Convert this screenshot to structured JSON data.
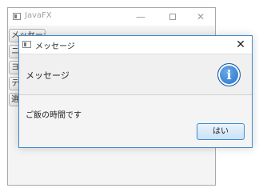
{
  "main_window": {
    "title": "JavaFX",
    "controls": {
      "minimize_icon": "minimize-icon",
      "maximize_icon": "maximize-icon",
      "close_icon": "close-icon",
      "minimize_glyph": "—",
      "close_glyph": "✕"
    },
    "side_buttons": [
      {
        "label": "メッセージ"
      },
      {
        "label": "ニ"
      },
      {
        "label": "ヨ"
      },
      {
        "label": "テ"
      },
      {
        "label": "選"
      }
    ]
  },
  "dialog": {
    "title": "メッセージ",
    "close_glyph": "✕",
    "header_text": "メッセージ",
    "info_icon_glyph": "i",
    "message": "ご飯の時間です",
    "ok_button_label": "はい",
    "accent_color": "#3c8bd2"
  }
}
